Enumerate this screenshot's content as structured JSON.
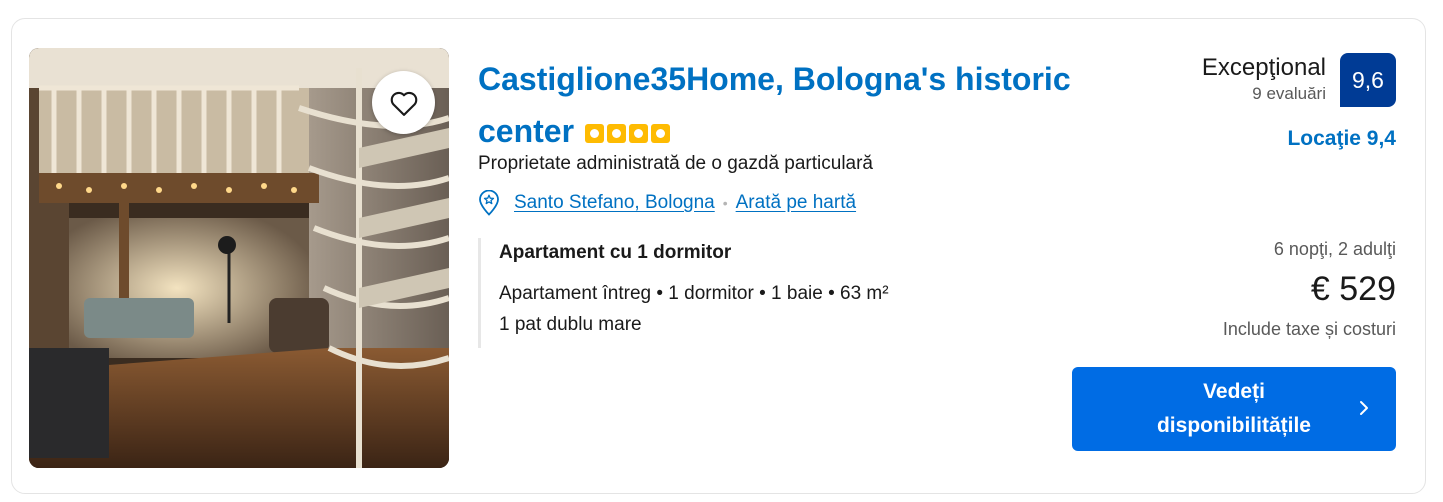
{
  "property": {
    "title": "Castiglione35Home, Bologna's historic center",
    "star_count": 4,
    "host_note": "Proprietate administrată de o gazdă particulară",
    "location": "Santo Stefano, Bologna",
    "map_link": "Arată pe hartă"
  },
  "room": {
    "name": "Apartament cu 1 dormitor",
    "details": "Apartament întreg • 1 dormitor • 1 baie • 63 m²",
    "bed": "1 pat dublu mare"
  },
  "review": {
    "word": "Excepţional",
    "count": "9 evaluări",
    "score": "9,6",
    "location_score": "Locaţie 9,4"
  },
  "pricing": {
    "stay": "6 nopţi, 2 adulţi",
    "price": "€ 529",
    "taxes": "Include taxe și costuri"
  },
  "cta": {
    "label": "Vedeți disponibilitățile"
  },
  "colors": {
    "link": "#0071c2",
    "score_badge": "#003b95",
    "cta": "#006ce4",
    "stars": "#febb02"
  },
  "icons": {
    "favorite": "heart-outline-icon",
    "location": "map-pin-icon",
    "cta": "chevron-right-icon"
  }
}
